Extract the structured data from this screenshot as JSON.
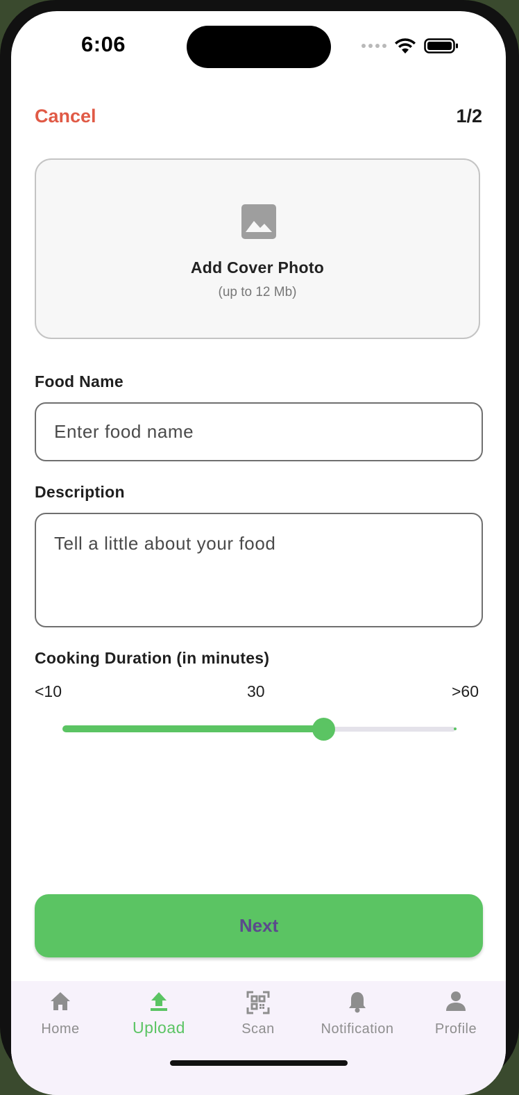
{
  "status_bar": {
    "time": "6:06"
  },
  "header": {
    "cancel_label": "Cancel",
    "step": "1/2"
  },
  "cover_photo": {
    "title": "Add Cover Photo",
    "subtitle": "(up to 12 Mb)",
    "icon": "image-icon"
  },
  "form": {
    "food_name": {
      "label": "Food Name",
      "placeholder": "Enter food name",
      "value": ""
    },
    "description": {
      "label": "Description",
      "placeholder": "Tell a little about your food",
      "value": ""
    },
    "cooking_duration": {
      "label": "Cooking Duration (in minutes)",
      "tick_min": "<10",
      "tick_mid": "30",
      "tick_max": ">60",
      "value_fraction": 0.665
    }
  },
  "next_label": "Next",
  "nav": {
    "items": [
      {
        "label": "Home",
        "icon": "home-icon",
        "active": false
      },
      {
        "label": "Upload",
        "icon": "upload-icon",
        "active": true
      },
      {
        "label": "Scan",
        "icon": "qr-scan-icon",
        "active": false
      },
      {
        "label": "Notification",
        "icon": "bell-icon",
        "active": false
      },
      {
        "label": "Profile",
        "icon": "person-icon",
        "active": false
      }
    ]
  },
  "colors": {
    "accent_green": "#5bc463",
    "cancel_red": "#e05a46",
    "next_text": "#5b4a8c",
    "inactive_nav": "#8e8e8e",
    "nav_bg": "#f7f2fb"
  }
}
